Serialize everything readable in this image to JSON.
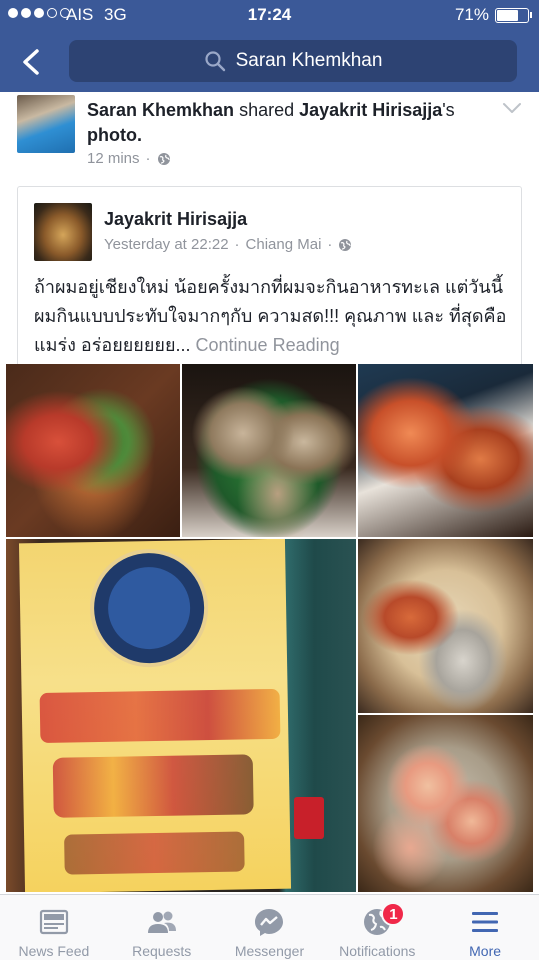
{
  "status_bar": {
    "carrier": "AIS",
    "network": "3G",
    "time": "17:24",
    "battery_percent": "71%",
    "battery_level": 0.71
  },
  "nav": {
    "search_text": "Saran Khemkhan",
    "icons": {
      "back": "chevron-left-icon",
      "search": "search-icon"
    }
  },
  "story": {
    "actor": "Saran Khemkhan",
    "action": "shared",
    "owner": "Jayakrit Hirisajja",
    "owner_suffix": "'s",
    "object": "photo.",
    "time": "12 mins",
    "separator": "·"
  },
  "shared_post": {
    "author": "Jayakrit Hirisajja",
    "time": "Yesterday at 22:22",
    "separator": "·",
    "location": "Chiang Mai",
    "text": "ถ้าผมอยู่เชียงใหม่ น้อยครั้งมากที่ผมจะกินอาหารทะเล แต่วันนี้ ผมกินแบบประทับใจมากๆกับ ความสด!!! คุณภาพ และ ที่สุดคือ แมร่ง อร่อยยยยยย...",
    "continue_label": "Continue Reading"
  },
  "tabbar": {
    "tabs": [
      {
        "label": "News Feed",
        "icon": "news-feed-icon",
        "active": false
      },
      {
        "label": "Requests",
        "icon": "friend-requests-icon",
        "active": false
      },
      {
        "label": "Messenger",
        "icon": "messenger-icon",
        "active": false
      },
      {
        "label": "Notifications",
        "icon": "globe-icon",
        "active": false,
        "badge": "1"
      },
      {
        "label": "More",
        "icon": "hamburger-menu-icon",
        "active": true
      }
    ]
  },
  "colors": {
    "brand_blue": "#3b5998",
    "active_tab": "#4267b2",
    "inactive_tab": "#929aa8",
    "badge_red": "#f02849",
    "meta_grey": "#90949c"
  }
}
